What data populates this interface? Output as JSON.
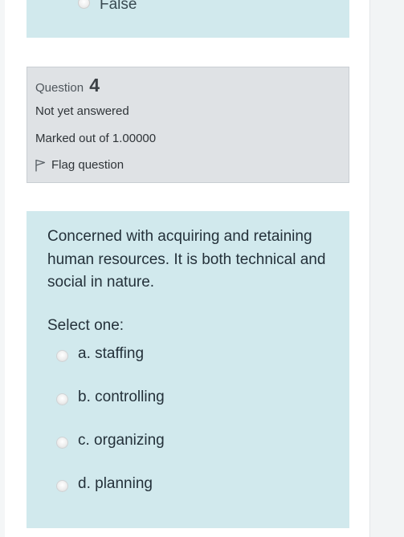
{
  "previous_question": {
    "last_option_label": "False"
  },
  "question_info": {
    "label": "Question",
    "number": "4",
    "state": "Not yet answered",
    "grade": "Marked out of 1.00000",
    "flag_label": "Flag question",
    "flag_icon": "flag-outline-icon"
  },
  "formulation": {
    "question_text": "Concerned with acquiring and retaining human resources. It is both technical and social in nature.",
    "prompt": "Select one:",
    "options": [
      {
        "label": "a. staffing"
      },
      {
        "label": "b. controlling"
      },
      {
        "label": "c. organizing"
      },
      {
        "label": "d. planning"
      }
    ]
  },
  "colors": {
    "formulation_bg": "#d1e9ed",
    "info_bg": "#dfe2e5",
    "text": "#24313a"
  }
}
